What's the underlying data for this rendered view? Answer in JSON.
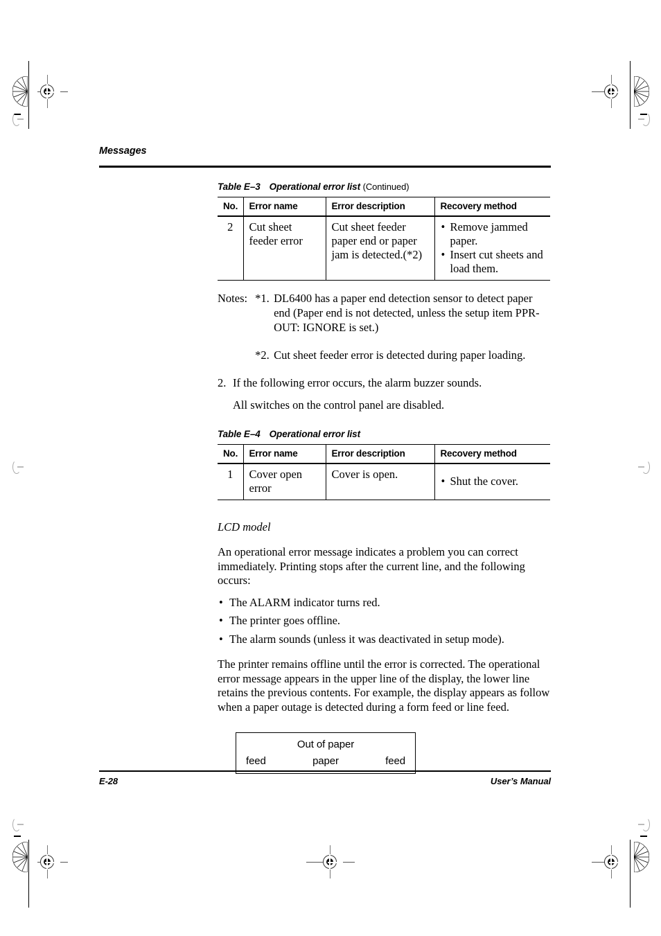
{
  "page": {
    "running_head": "Messages",
    "footer_left": "E-28",
    "footer_right": "User’s Manual"
  },
  "table_e3": {
    "caption_number": "Table E–3",
    "caption_title": "Operational error list",
    "caption_continued": "(Continued)",
    "headers": [
      "No.",
      "Error name",
      "Error description",
      "Recovery method"
    ],
    "rows": [
      {
        "no": "2",
        "error_name": "Cut sheet feeder error",
        "error_description": "Cut sheet feeder paper end or paper jam is detected.(*2)",
        "recovery": [
          "Remove jammed paper.",
          "Insert cut sheets and load them."
        ]
      }
    ]
  },
  "notes": {
    "label": "Notes:",
    "items": [
      {
        "marker": "*1.",
        "text": "DL6400 has a paper end detection sensor to detect paper end (Paper end is not detected, unless the setup item PPR-OUT: IGNORE is set.)"
      },
      {
        "marker": "*2.",
        "text": "Cut sheet feeder error is detected during paper loading."
      }
    ]
  },
  "item2": {
    "number": "2.",
    "text": "If the following error occurs, the alarm buzzer sounds.",
    "subtext": "All switches on the control panel are disabled."
  },
  "table_e4": {
    "caption_number": "Table E–4",
    "caption_title": "Operational error list",
    "headers": [
      "No.",
      "Error name",
      "Error description",
      "Recovery method"
    ],
    "rows": [
      {
        "no": "1",
        "error_name": "Cover open error",
        "error_description": "Cover is open.",
        "recovery": [
          "Shut the cover."
        ]
      }
    ]
  },
  "lcd_section": {
    "heading": "LCD model",
    "intro": "An operational error message indicates a problem you can correct immediately. Printing stops after the current line, and the following occurs:",
    "bullets": [
      "The ALARM indicator turns red.",
      "The printer goes offline.",
      "The alarm sounds (unless it was deactivated in setup mode)."
    ],
    "paragraph": "The printer remains offline until the error is corrected. The operational error message appears in the upper line of the display, the lower line retains the previous contents. For example, the display appears as follow when a paper outage is detected during a form feed or line feed.",
    "display": {
      "upper_line": "Out of paper",
      "lower_left": "feed",
      "lower_center": "paper",
      "lower_right": "feed"
    }
  }
}
